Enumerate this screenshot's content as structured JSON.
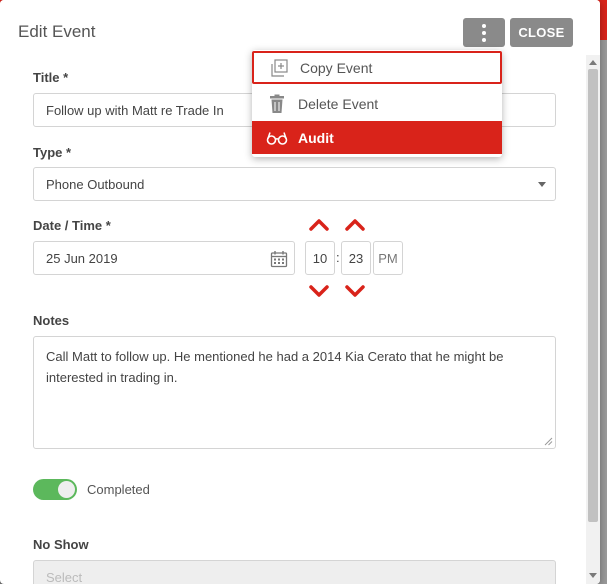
{
  "dialog": {
    "title": "Edit Event",
    "close_label": "CLOSE"
  },
  "menu": {
    "items": [
      {
        "label": "Copy Event",
        "icon": "copy-icon"
      },
      {
        "label": "Delete Event",
        "icon": "trash-icon"
      },
      {
        "label": "Audit",
        "icon": "glasses-icon"
      }
    ],
    "accent": "#d9231a"
  },
  "form": {
    "title_label": "Title *",
    "title_value": "Follow up with Matt re Trade In",
    "type_label": "Type *",
    "type_value": "Phone Outbound",
    "datetime_label": "Date / Time *",
    "date_value": "25 Jun 2019",
    "hour": "10",
    "time_separator": ":",
    "minute": "23",
    "ampm": "PM",
    "notes_label": "Notes",
    "notes_value": "Call Matt to follow up.  He mentioned he had a 2014 Kia Cerato that he might be interested in trading in.",
    "completed_label": "Completed",
    "completed": true,
    "no_show_label": "No Show",
    "no_show_placeholder": "Select"
  },
  "colors": {
    "accent_red": "#d9231a",
    "toggle_green": "#5cb85c",
    "button_gray": "#8a8a8a"
  }
}
